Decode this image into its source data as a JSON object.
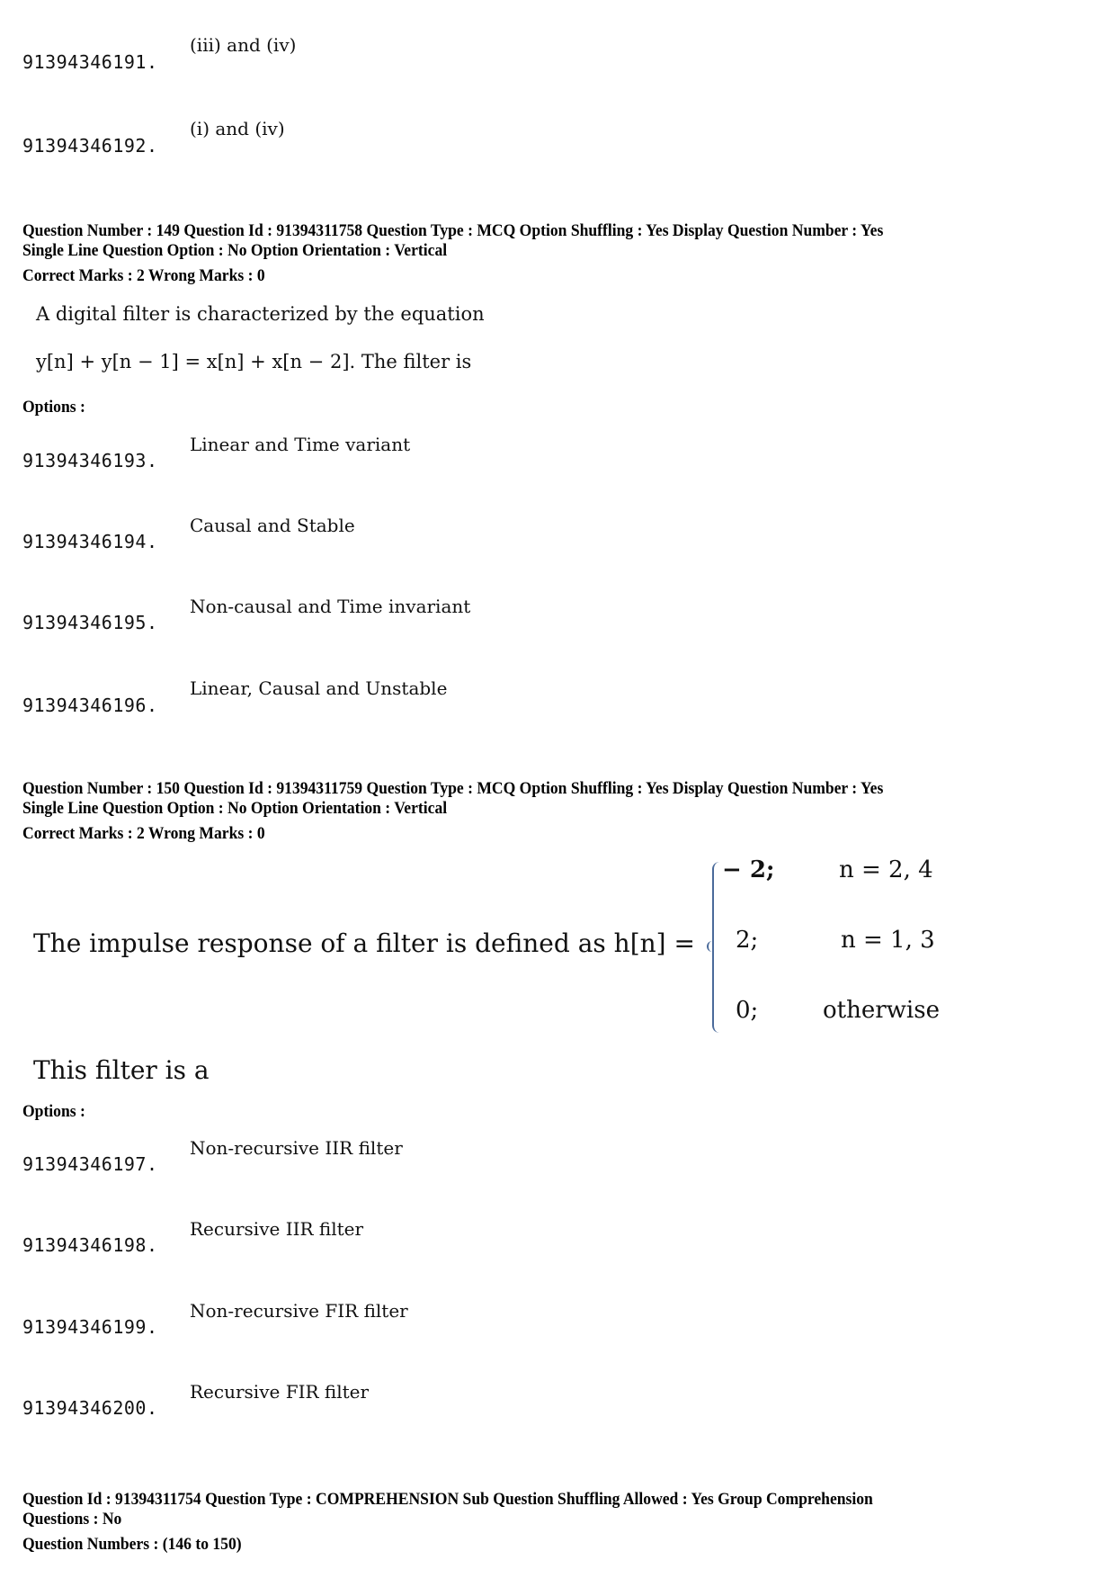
{
  "previous_question": {
    "options": [
      {
        "id": "91394346191.",
        "text": "(iii) and (iv)"
      },
      {
        "id": "91394346192.",
        "text": "(i) and (iv)"
      }
    ]
  },
  "question_149": {
    "meta_line1": "Question Number : 149  Question Id : 91394311758  Question Type : MCQ  Option Shuffling : Yes  Display Question Number : Yes",
    "meta_line2": "Single Line Question Option : No  Option Orientation : Vertical",
    "marks": "Correct Marks : 2  Wrong Marks : 0",
    "text_line1": "A digital filter is characterized by the equation",
    "text_line2": "y[n] + y[n − 1] = x[n] + x[n − 2]. The filter is",
    "options_label": "Options :",
    "options": [
      {
        "id": "91394346193.",
        "text": "Linear and Time variant"
      },
      {
        "id": "91394346194.",
        "text": "Causal and Stable"
      },
      {
        "id": "91394346195.",
        "text": "Non-causal and Time invariant"
      },
      {
        "id": "91394346196.",
        "text": "Linear, Causal and Unstable"
      }
    ]
  },
  "question_150": {
    "meta_line1": "Question Number : 150  Question Id : 91394311759  Question Type : MCQ  Option Shuffling : Yes  Display Question Number : Yes",
    "meta_line2": "Single Line Question Option : No  Option Orientation : Vertical",
    "marks": "Correct Marks : 2  Wrong Marks : 0",
    "text_prefix": "The impulse response of a filter is defined as h[n] =",
    "piecewise": [
      {
        "value": "− 2;",
        "condition": "n = 2, 4"
      },
      {
        "value": "2;",
        "condition": "n = 1, 3"
      },
      {
        "value": "0;",
        "condition": "otherwise"
      }
    ],
    "text_line2": "This filter is a",
    "options_label": "Options :",
    "options": [
      {
        "id": "91394346197.",
        "text": "Non-recursive IIR filter"
      },
      {
        "id": "91394346198.",
        "text": "Recursive IIR filter"
      },
      {
        "id": "91394346199.",
        "text": "Non-recursive FIR filter"
      },
      {
        "id": "91394346200.",
        "text": "Recursive FIR filter"
      }
    ]
  },
  "comprehension": {
    "meta_line1": "Question Id : 91394311754  Question Type : COMPREHENSION  Sub Question Shuffling Allowed : Yes  Group Comprehension",
    "meta_line2": "Questions : No",
    "question_numbers": "Question Numbers : (146 to 150)"
  }
}
